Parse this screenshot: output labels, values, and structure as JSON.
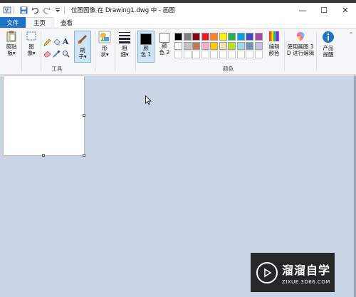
{
  "window": {
    "title": "位图图像 在 Drawing1.dwg 中 - 画图",
    "controls": {
      "minimize": "—",
      "maximize": "☐",
      "close": "✕"
    }
  },
  "tabs": [
    {
      "label": "文件"
    },
    {
      "label": "主页"
    },
    {
      "label": "查看"
    }
  ],
  "ribbon": {
    "clipboard": {
      "label_line1": "剪贴",
      "label_line2": "板▾"
    },
    "image": {
      "label_line1": "图",
      "label_line2": "像▾"
    },
    "tools": {
      "group_label": "工具"
    },
    "brushes": {
      "label_line1": "刷",
      "label_line2": "子▾"
    },
    "shapes": {
      "label_line1": "形",
      "label_line2": "状▾"
    },
    "size": {
      "label_line1": "粗",
      "label_line2": "细▾"
    },
    "color1": {
      "label_line1": "颜",
      "label_line2": "色 1",
      "value": "#000000"
    },
    "color2": {
      "label_line1": "颜",
      "label_line2": "色 2",
      "value": "#ffffff"
    },
    "colors_group": {
      "group_label": "颜色"
    },
    "edit_colors": {
      "label_line1": "编辑",
      "label_line2": "颜色"
    },
    "paint3d": {
      "label_line1": "使用画图 3",
      "label_line2": "D 进行编辑"
    },
    "product_alert": {
      "label_line1": "产品",
      "label_line2": "提醒"
    }
  },
  "palette_row1": [
    "#000000",
    "#7f7f7f",
    "#880015",
    "#ed1c24",
    "#ff7f27",
    "#fff200",
    "#22b14c",
    "#00a2e8",
    "#3f48cc",
    "#a349a4"
  ],
  "palette_row2": [
    "#ffffff",
    "#c3c3c3",
    "#b97a57",
    "#ffaec9",
    "#ffc90e",
    "#efe4b0",
    "#b5e61d",
    "#99d9ea",
    "#7092be",
    "#c8bfe7"
  ],
  "watermark": {
    "title": "溜溜自学",
    "subtitle": "ZIXUE.3D66.COM"
  },
  "colors": {
    "accent": "#1e73c8",
    "canvas_bg": "#c9d4e4"
  }
}
